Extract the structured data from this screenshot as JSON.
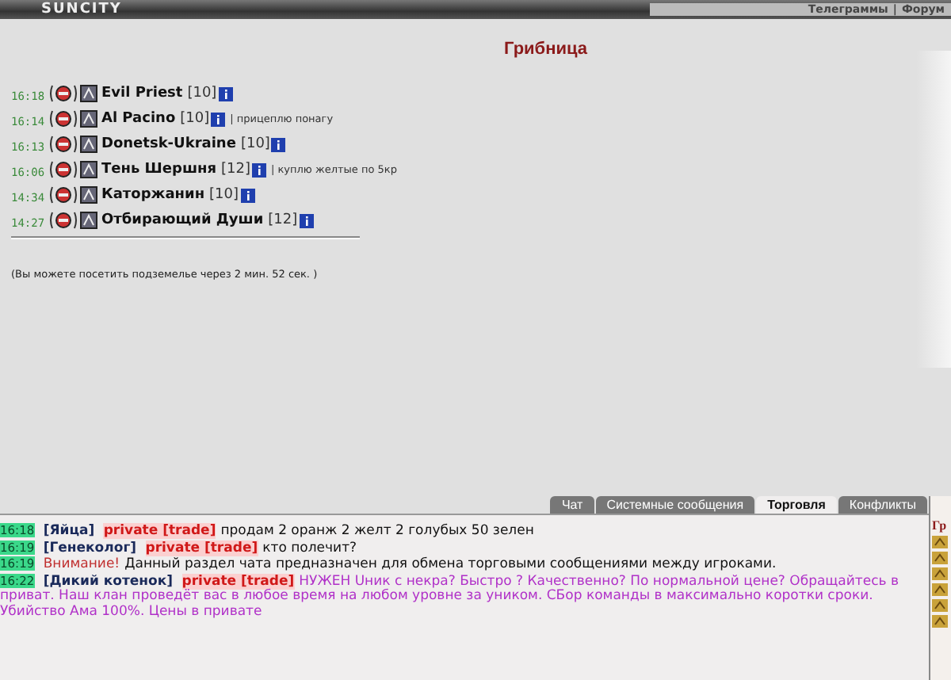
{
  "header": {
    "logo": "SUNCITY",
    "links": [
      "Телеграммы",
      "Форум"
    ],
    "separator": "|"
  },
  "location": {
    "title": "Грибница",
    "players": [
      {
        "time": "16:18",
        "name": "Evil Priest",
        "level": "[10]"
      },
      {
        "time": "16:14",
        "name": "Al Pacino",
        "level": "[10]",
        "note": "| прицеплю понагу"
      },
      {
        "time": "16:13",
        "name": "Donetsk-Ukraine",
        "level": "[10]"
      },
      {
        "time": "16:06",
        "name": "Тень Шершня",
        "level": "[12]",
        "note": "| куплю желтые по 5кр"
      },
      {
        "time": "14:34",
        "name": "Каторжанин",
        "level": "[10]"
      },
      {
        "time": "14:27",
        "name": "Отбирающий Души",
        "level": "[12]"
      }
    ],
    "notice": "(Вы можете посетить подземелье через 2 мин. 52 сек. )"
  },
  "chat": {
    "tabs": [
      {
        "label": "Чат",
        "selected": false
      },
      {
        "label": "Системные сообщения",
        "selected": false
      },
      {
        "label": "Торговля",
        "selected": true
      },
      {
        "label": "Конфликты",
        "selected": false
      }
    ],
    "messages": [
      {
        "kind": "private",
        "time": "16:18",
        "nick": "[Яйца]",
        "tag": "private [trade]",
        "text": "продам 2 оранж 2 желт 2 голубых 50 зелен",
        "highlighted": false
      },
      {
        "kind": "private",
        "time": "16:19",
        "nick": "[Генеколог]",
        "tag": "private [trade]",
        "text": "кто полечит?",
        "highlighted": false
      },
      {
        "kind": "system",
        "time": "16:19",
        "nick": "Внимание!",
        "text": "Данный раздел чата предназначен для обмена торговыми сообщениями между игроками.",
        "highlighted": false
      },
      {
        "kind": "private",
        "time": "16:22",
        "nick": "[Дикий котенок]",
        "tag": "private [trade]",
        "text": "НУЖЕН Uник с некра? Быстро ? Качественно? По нормальной цене? Обращайтесь в приват. Наш клан проведёт вас в любое время на любом уровне за уником. СБор команды в максимально коротки сроки. Убийство Ама 100%. Цены в привате",
        "highlighted": true
      }
    ]
  },
  "side_panel": {
    "title": "Гр"
  }
}
